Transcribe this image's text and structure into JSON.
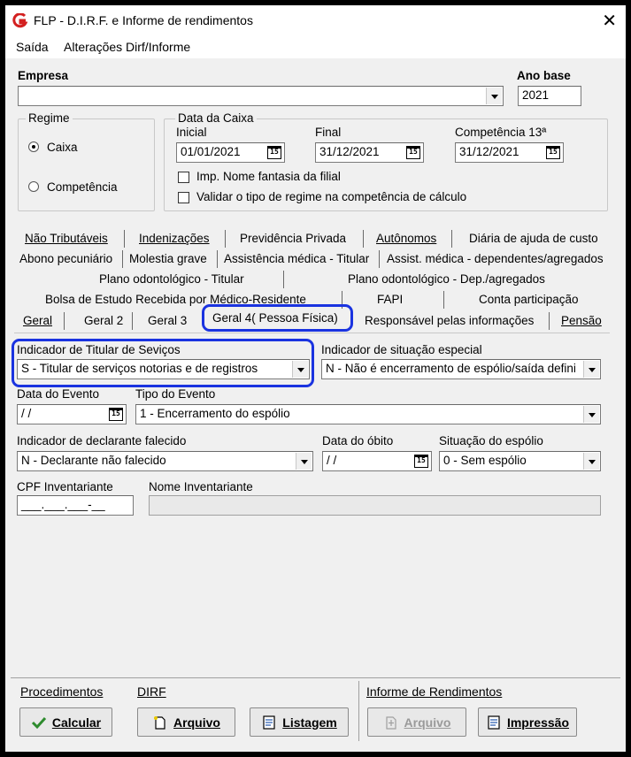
{
  "window": {
    "title": "FLP - D.I.R.F. e Informe de rendimentos"
  },
  "menu": [
    "Saída",
    "Alterações Dirf/Informe"
  ],
  "empresa": {
    "label": "Empresa",
    "value": ""
  },
  "ano_base": {
    "label": "Ano base",
    "value": "2021"
  },
  "regime": {
    "title": "Regime",
    "options": [
      "Caixa",
      "Competência"
    ],
    "selected": "Caixa"
  },
  "data_caixa": {
    "title": "Data da Caixa",
    "inicial_label": "Inicial",
    "inicial": "01/01/2021",
    "final_label": "Final",
    "final": "31/12/2021",
    "comp13_label": "Competência 13ª",
    "comp13": "31/12/2021",
    "chk_fantasia": "Imp. Nome fantasia da filial",
    "chk_validar": "Validar o tipo de regime na competência de cálculo"
  },
  "tabs": {
    "row1": [
      "Não Tributáveis",
      "Indenizações",
      "Previdência Privada",
      "Autônomos",
      "Diária de ajuda de custo"
    ],
    "row2": [
      "Abono pecuniário",
      "Molestia grave",
      "Assistência médica - Titular",
      "Assist. médica - dependentes/agregados"
    ],
    "row3": [
      "Plano odontológico - Titular",
      "Plano odontológico - Dep./agregados"
    ],
    "row4": [
      "Bolsa de Estudo Recebida por Médico-Residente",
      "FAPI",
      "Conta participação"
    ],
    "row5": [
      "Geral",
      "Geral 2",
      "Geral 3",
      "Geral 4( Pessoa Física)",
      "Responsável pelas informações",
      "Pensão"
    ],
    "active": "Geral 4( Pessoa Física)"
  },
  "form": {
    "titular_label": "Indicador de Titular de Seviços",
    "titular_value": "S - Titular de serviços notorias e de registros",
    "situacao_especial_label": "Indicador de situação especial",
    "situacao_especial_value": "N - Não é encerramento de espólio/saída defini",
    "data_evento_label": "Data do Evento",
    "data_evento_value": " / /",
    "tipo_evento_label": "Tipo do Evento",
    "tipo_evento_value": "1 - Encerramento do espólio",
    "declarante_label": "Indicador de declarante falecido",
    "declarante_value": "N - Declarante não falecido",
    "data_obito_label": "Data do óbito",
    "data_obito_value": " / /",
    "situacao_espolio_label": "Situação do espólio",
    "situacao_espolio_value": "0 - Sem espólio",
    "cpf_label": "CPF Inventariante",
    "cpf_value": "___.___.___-__",
    "nome_inv_label": "Nome Inventariante",
    "nome_inv_value": ""
  },
  "footer": {
    "procedimentos": "Procedimentos",
    "dirf": "DIRF",
    "informe": "Informe de Rendimentos",
    "calcular": "Calcular",
    "arquivo": "Arquivo",
    "listagem": "Listagem",
    "arquivo_informe": "Arquivo",
    "impressao": "Impressão"
  },
  "colors": {
    "highlight": "#1a33e0",
    "logo": "#d32020",
    "check": "#2e8b2e"
  }
}
